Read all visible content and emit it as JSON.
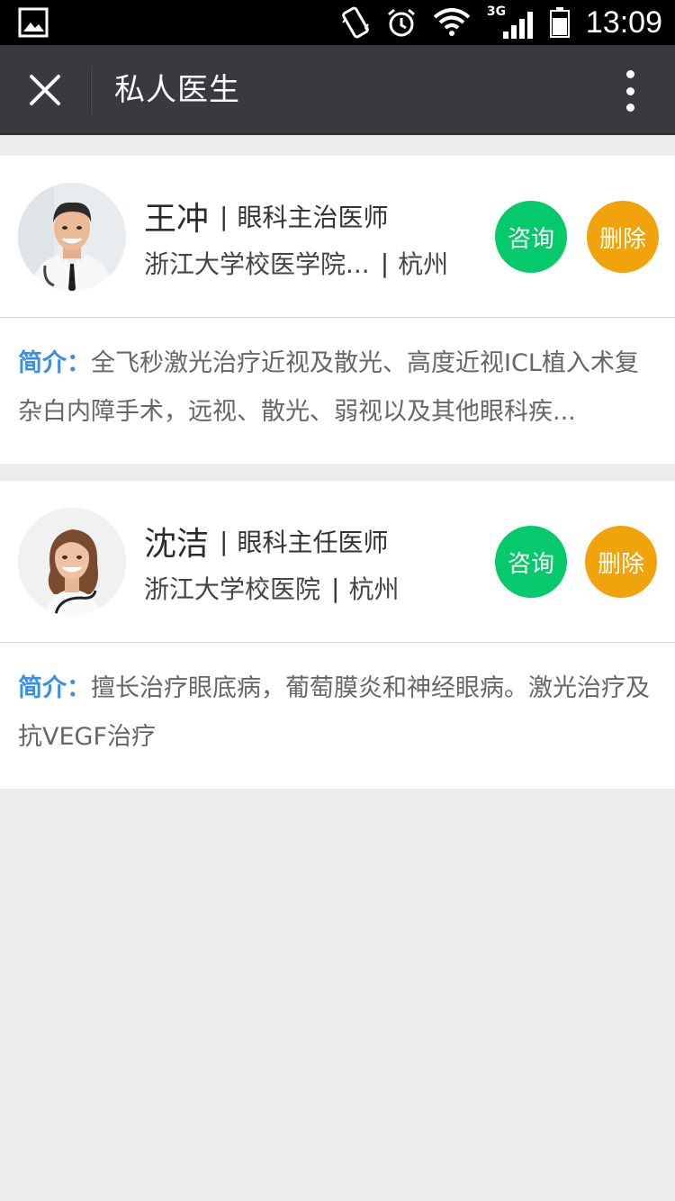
{
  "status_bar": {
    "time": "13:09",
    "network": "3G",
    "icons": [
      "image-icon",
      "vibrate-icon",
      "alarm-icon",
      "wifi-icon",
      "signal-icon",
      "battery-icon"
    ]
  },
  "nav": {
    "title": "私人医生",
    "close_icon": "close-icon",
    "more_icon": "more-vertical-icon"
  },
  "doctors": [
    {
      "name": "王冲",
      "title": "眼科主治医师",
      "hospital": "浙江大学校医学院...",
      "city": "杭州",
      "consult_label": "咨询",
      "delete_label": "删除",
      "intro_label": "简介：",
      "intro": "全飞秒激光治疗近视及散光、高度近视ICL植入术复杂白内障手术，远视、散光、弱视以及其他眼科疾..."
    },
    {
      "name": "沈洁",
      "title": "眼科主任医师",
      "hospital": "浙江大学校医院",
      "city": "杭州",
      "consult_label": "咨询",
      "delete_label": "删除",
      "intro_label": "简介：",
      "intro": "擅长治疗眼底病，葡萄膜炎和神经眼病。激光治疗及抗VEGF治疗"
    }
  ],
  "colors": {
    "consult_button": "#05c96b",
    "delete_button": "#f0a30a",
    "intro_label": "#3a8ee6",
    "navbar": "#393a3f"
  }
}
